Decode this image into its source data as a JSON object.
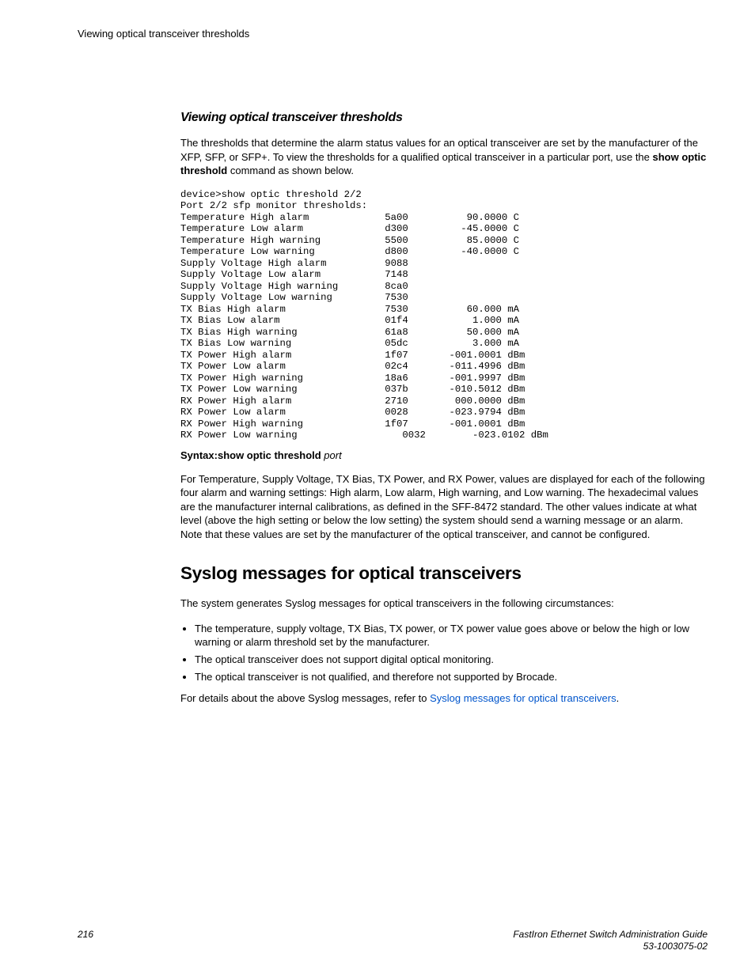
{
  "header": {
    "running_head": "Viewing optical transceiver thresholds"
  },
  "section1": {
    "heading": "Viewing optical transceiver thresholds",
    "intro_pre": "The thresholds that determine the alarm status values for an optical transceiver are set by the manufacturer of the XFP, SFP, or SFP+. To view the thresholds for a qualified optical transceiver in a particular port, use the ",
    "intro_bold": "show optic threshold",
    "intro_post": " command as shown below.",
    "code": "device>show optic threshold 2/2\nPort 2/2 sfp monitor thresholds:\nTemperature High alarm             5a00          90.0000 C\nTemperature Low alarm              d300         -45.0000 C\nTemperature High warning           5500          85.0000 C\nTemperature Low warning            d800         -40.0000 C\nSupply Voltage High alarm          9088\nSupply Voltage Low alarm           7148\nSupply Voltage High warning        8ca0\nSupply Voltage Low warning         7530\nTX Bias High alarm                 7530          60.000 mA\nTX Bias Low alarm                  01f4           1.000 mA\nTX Bias High warning               61a8          50.000 mA\nTX Bias Low warning                05dc           3.000 mA\nTX Power High alarm                1f07       -001.0001 dBm\nTX Power Low alarm                 02c4       -011.4996 dBm\nTX Power High warning              18a6       -001.9997 dBm\nTX Power Low warning               037b       -010.5012 dBm\nRX Power High alarm                2710        000.0000 dBm\nRX Power Low alarm                 0028       -023.9794 dBm\nRX Power High warning              1f07       -001.0001 dBm\nRX Power Low warning                  0032        -023.0102 dBm",
    "syntax_bold": "Syntax:show optic threshold",
    "syntax_italic": " port",
    "explain": "For Temperature, Supply Voltage, TX Bias, TX Power, and RX Power, values are displayed for each of the following four alarm and warning settings: High alarm, Low alarm, High warning, and Low warning. The hexadecimal values are the manufacturer internal calibrations, as defined in the SFF-8472 standard. The other values indicate at what level (above the high setting or below the low setting) the system should send a warning message or an alarm. Note that these values are set by the manufacturer of the optical transceiver, and cannot be configured."
  },
  "section2": {
    "heading": "Syslog messages for optical transceivers",
    "intro": "The system generates Syslog messages for optical transceivers in the following circumstances:",
    "bullets": [
      "The temperature, supply voltage, TX Bias, TX power, or TX power value goes above or below the high or low warning or alarm threshold set by the manufacturer.",
      "The optical transceiver does not support digital optical monitoring.",
      "The optical transceiver is not qualified, and therefore not supported by Brocade."
    ],
    "outro_pre": "For details about the above Syslog messages, refer to ",
    "outro_link": "Syslog messages for optical transceivers",
    "outro_post": "."
  },
  "footer": {
    "page": "216",
    "doc_title": "FastIron Ethernet Switch Administration Guide",
    "doc_num": "53-1003075-02"
  }
}
